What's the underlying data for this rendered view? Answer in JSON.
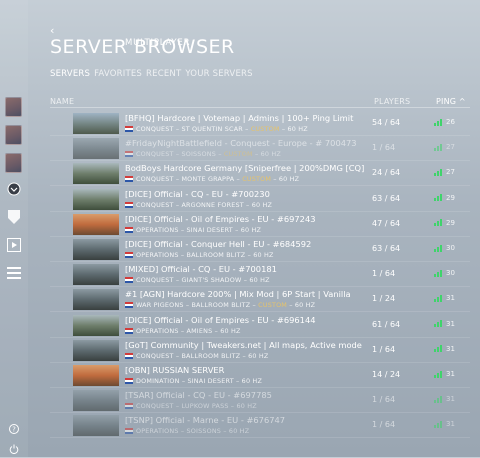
{
  "header": {
    "back_label": "MULTIPLAYER",
    "title": "SERVER BROWSER",
    "tabs": [
      {
        "label": "SERVERS",
        "active": true
      },
      {
        "label": "FAVORITES",
        "active": false
      },
      {
        "label": "RECENT",
        "active": false
      },
      {
        "label": "YOUR SERVERS",
        "active": false
      }
    ]
  },
  "columns": {
    "name": "NAME",
    "players": "PLAYERS",
    "ping": "PING ^"
  },
  "sidebar": {
    "icons": [
      "avatar-1",
      "avatar-2",
      "avatar-3",
      "rank-badge-icon",
      "shield-icon",
      "play-icon",
      "list-icon",
      "help-icon",
      "power-icon"
    ]
  },
  "colors": {
    "accent_custom": "#e6c36a",
    "ping_good": "#3fd46b"
  },
  "servers": [
    {
      "name": "[BFHQ] Hardcore | Votemap | Admins | 100+ Ping Limit",
      "mode": "CONQUEST",
      "map": "ST QUENTIN SCAR",
      "custom": "CUSTOM",
      "hz": "60 HZ",
      "players": "54 / 64",
      "ping": "26",
      "dim": false
    },
    {
      "name": "#FridayNightBattlefield - Conquest - Europe - # 700473",
      "mode": "CONQUEST",
      "map": "SOISSONS",
      "custom": "CUSTOM",
      "hz": "60 HZ",
      "players": "1 / 64",
      "ping": "27",
      "dim": true
    },
    {
      "name": "BodBoys Hardcore Germany [Sniperfree | 200%DMG [CQ]",
      "mode": "CONQUEST",
      "map": "MONTE GRAPPA",
      "custom": "CUSTOM",
      "hz": "60 HZ",
      "players": "24 / 64",
      "ping": "27",
      "dim": false
    },
    {
      "name": "[DICE] Official - CQ - EU - #700230",
      "mode": "CONQUEST",
      "map": "ARGONNE FOREST",
      "custom": "",
      "hz": "60 HZ",
      "players": "63 / 64",
      "ping": "29",
      "dim": false
    },
    {
      "name": "[DICE] Official - Oil of Empires - EU - #697243",
      "mode": "OPERATIONS",
      "map": "SINAI DESERT",
      "custom": "",
      "hz": "60 HZ",
      "players": "47 / 64",
      "ping": "29",
      "dim": false
    },
    {
      "name": "[DICE] Official - Conquer Hell - EU - #684592",
      "mode": "OPERATIONS",
      "map": "BALLROOM BLITZ",
      "custom": "",
      "hz": "60 HZ",
      "players": "63 / 64",
      "ping": "30",
      "dim": false
    },
    {
      "name": "[MIXED] Official - CQ - EU - #700181",
      "mode": "CONQUEST",
      "map": "GIANT'S SHADOW",
      "custom": "",
      "hz": "60 HZ",
      "players": "1 / 64",
      "ping": "30",
      "dim": false
    },
    {
      "name": "#1 [AGN] Hardcore 200% | Mix Mod | 6P Start | Vanilla",
      "mode": "WAR PIGEONS",
      "map": "BALLROOM BLITZ",
      "custom": "CUSTOM",
      "hz": "60 HZ",
      "players": "1 / 24",
      "ping": "31",
      "dim": false
    },
    {
      "name": "[DICE] Official - Oil of Empires - EU - #696144",
      "mode": "OPERATIONS",
      "map": "AMIENS",
      "custom": "",
      "hz": "60 HZ",
      "players": "61 / 64",
      "ping": "31",
      "dim": false
    },
    {
      "name": "[GoT] Community | Tweakers.net | All maps, Active mode",
      "mode": "CONQUEST",
      "map": "BALLROOM BLITZ",
      "custom": "",
      "hz": "60 HZ",
      "players": "1 / 64",
      "ping": "31",
      "dim": false
    },
    {
      "name": "[OBN] RUSSIAN SERVER",
      "mode": "DOMINATION",
      "map": "SINAI DESERT",
      "custom": "",
      "hz": "60 HZ",
      "players": "14 / 24",
      "ping": "31",
      "dim": false
    },
    {
      "name": "[TSAR] Official - CQ - EU - #697785",
      "mode": "CONQUEST",
      "map": "LUPKOW PASS",
      "custom": "",
      "hz": "60 HZ",
      "players": "1 / 64",
      "ping": "31",
      "dim": true
    },
    {
      "name": "[TSNP] Official - Marne - EU - #676747",
      "mode": "OPERATIONS",
      "map": "SOISSONS",
      "custom": "",
      "hz": "60 HZ",
      "players": "1 / 64",
      "ping": "31",
      "dim": true
    }
  ]
}
